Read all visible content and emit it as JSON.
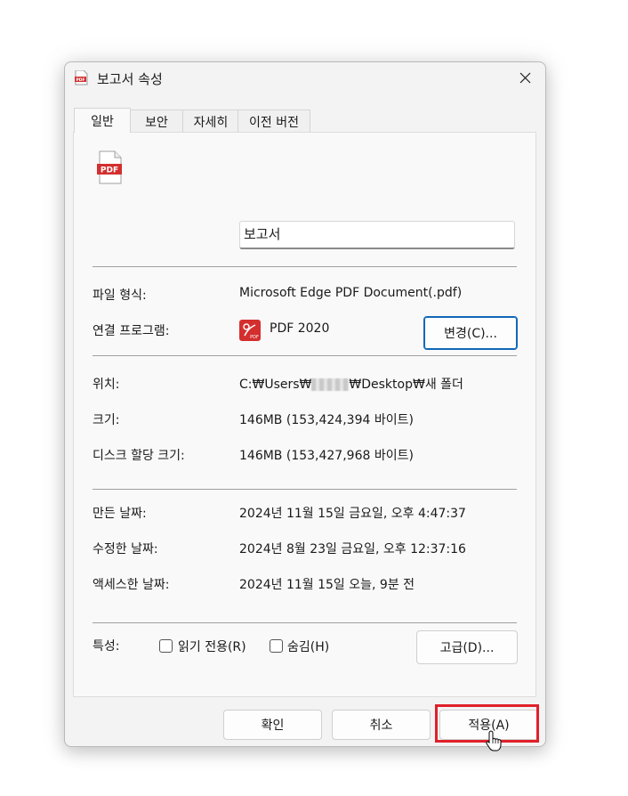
{
  "window": {
    "title": "보고서 속성",
    "icon": "pdf-file-icon",
    "close": "close-icon"
  },
  "tabs": [
    "일반",
    "보안",
    "자세히",
    "이전 버전"
  ],
  "general": {
    "file_name": "보고서",
    "file_type_label": "파일 형식:",
    "file_type_value": "Microsoft Edge PDF Document(.pdf)",
    "opens_with_label": "연결 프로그램:",
    "opens_with_value": "PDF 2020",
    "change_button": "변경(C)...",
    "location_label": "위치:",
    "location_value_prefix": "C:₩Users₩",
    "location_value_suffix": "₩Desktop₩새 폴더",
    "size_label": "크기:",
    "size_value": "146MB (153,424,394 바이트)",
    "disk_size_label": "디스크 할당 크기:",
    "disk_size_value": "146MB (153,427,968 바이트)",
    "created_label": "만든 날짜:",
    "created_value": "2024년 11월 15일 금요일, 오후 4:47:37",
    "modified_label": "수정한 날짜:",
    "modified_value": "2024년 8월 23일 금요일, 오후 12:37:16",
    "accessed_label": "액세스한 날짜:",
    "accessed_value": "2024년 11월 15일 오늘, 9분 전",
    "attributes_label": "특성:",
    "readonly_label": "읽기 전용(R)",
    "hidden_label": "숨김(H)",
    "advanced_button": "고급(D)..."
  },
  "footer": {
    "ok": "확인",
    "cancel": "취소",
    "apply": "적용(A)"
  },
  "colors": {
    "highlight": "#e0202a",
    "pdf_red": "#d32f2f",
    "focus_blue": "#0f67b8"
  }
}
